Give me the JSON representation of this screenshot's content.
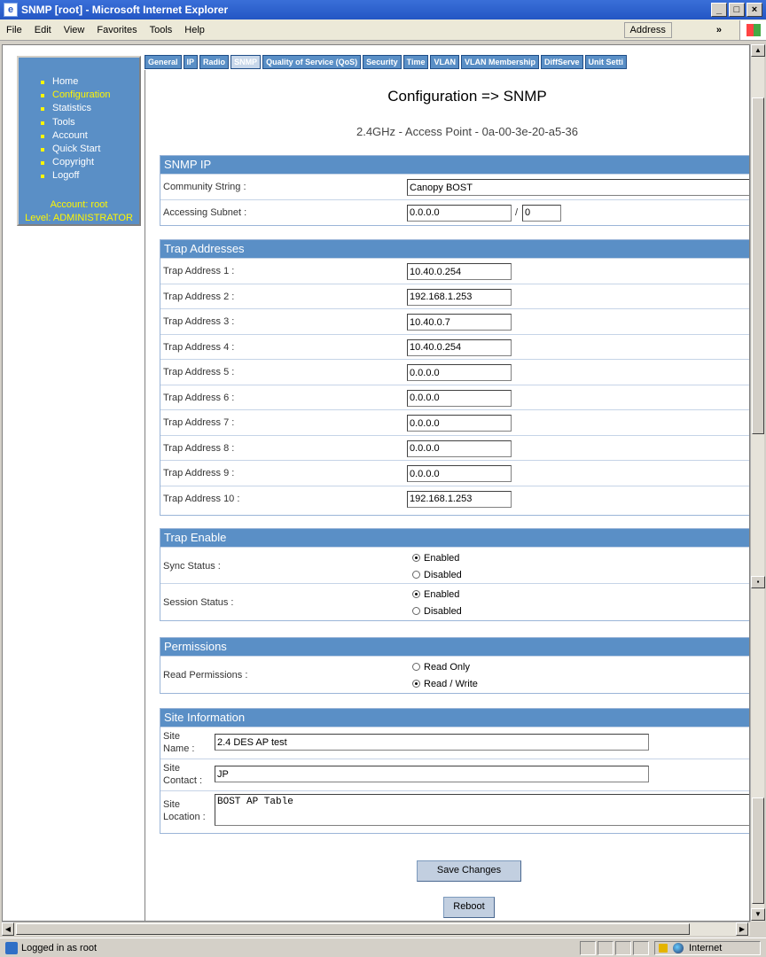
{
  "window": {
    "title": "SNMP [root] - Microsoft Internet Explorer",
    "min": "_",
    "max": "□",
    "close": "×"
  },
  "menubar": {
    "items": [
      "File",
      "Edit",
      "View",
      "Favorites",
      "Tools",
      "Help"
    ],
    "address_label": "Address",
    "chevron": "»"
  },
  "nav": {
    "items": [
      {
        "label": "Home",
        "active": false
      },
      {
        "label": "Configuration",
        "active": true
      },
      {
        "label": "Statistics",
        "active": false
      },
      {
        "label": "Tools",
        "active": false
      },
      {
        "label": "Account",
        "active": false
      },
      {
        "label": "Quick Start",
        "active": false
      },
      {
        "label": "Copyright",
        "active": false
      },
      {
        "label": "Logoff",
        "active": false
      }
    ],
    "account": "Account: root",
    "level": "Level: ADMINISTRATOR"
  },
  "tabs": [
    "General",
    "IP",
    "Radio",
    "SNMP",
    "Quality of Service (QoS)",
    "Security",
    "Time",
    "VLAN",
    "VLAN Membership",
    "DiffServe",
    "Unit Setti"
  ],
  "active_tab": "SNMP",
  "page": {
    "title": "Configuration => SNMP",
    "subtitle": "2.4GHz - Access Point - 0a-00-3e-20-a5-36"
  },
  "snmp_ip": {
    "header": "SNMP IP",
    "community_label": "Community String :",
    "community_value": "Canopy BOST",
    "subnet_label": "Accessing Subnet :",
    "subnet_value": "0.0.0.0",
    "subnet_sep": "/",
    "subnet_mask": "0"
  },
  "trap_addresses": {
    "header": "Trap Addresses",
    "rows": [
      {
        "label": "Trap Address 1 :",
        "value": "10.40.0.254"
      },
      {
        "label": "Trap Address 2 :",
        "value": "192.168.1.253"
      },
      {
        "label": "Trap Address 3 :",
        "value": "10.40.0.7"
      },
      {
        "label": "Trap Address 4 :",
        "value": "10.40.0.254"
      },
      {
        "label": "Trap Address 5 :",
        "value": "0.0.0.0"
      },
      {
        "label": "Trap Address 6 :",
        "value": "0.0.0.0"
      },
      {
        "label": "Trap Address 7 :",
        "value": "0.0.0.0"
      },
      {
        "label": "Trap Address 8 :",
        "value": "0.0.0.0"
      },
      {
        "label": "Trap Address 9 :",
        "value": "0.0.0.0"
      },
      {
        "label": "Trap Address 10 :",
        "value": "192.168.1.253"
      }
    ]
  },
  "trap_enable": {
    "header": "Trap Enable",
    "sync_label": "Sync Status :",
    "session_label": "Session Status :",
    "enabled": "Enabled",
    "disabled": "Disabled",
    "sync_selected": "Enabled",
    "session_selected": "Enabled"
  },
  "permissions": {
    "header": "Permissions",
    "read_label": "Read Permissions :",
    "read_only": "Read Only",
    "read_write": "Read / Write",
    "selected": "Read / Write"
  },
  "site": {
    "header": "Site Information",
    "name_label_1": "Site",
    "name_label_2": "Name :",
    "name_value": "2.4 DES AP test",
    "contact_label_1": "Site",
    "contact_label_2": "Contact :",
    "contact_value": "JP",
    "location_label_1": "Site",
    "location_label_2": "Location :",
    "location_value": "BOST AP Table"
  },
  "buttons": {
    "save": "Save Changes",
    "reboot": "Reboot"
  },
  "status": {
    "text": "Logged in as root",
    "zone": "Internet"
  }
}
